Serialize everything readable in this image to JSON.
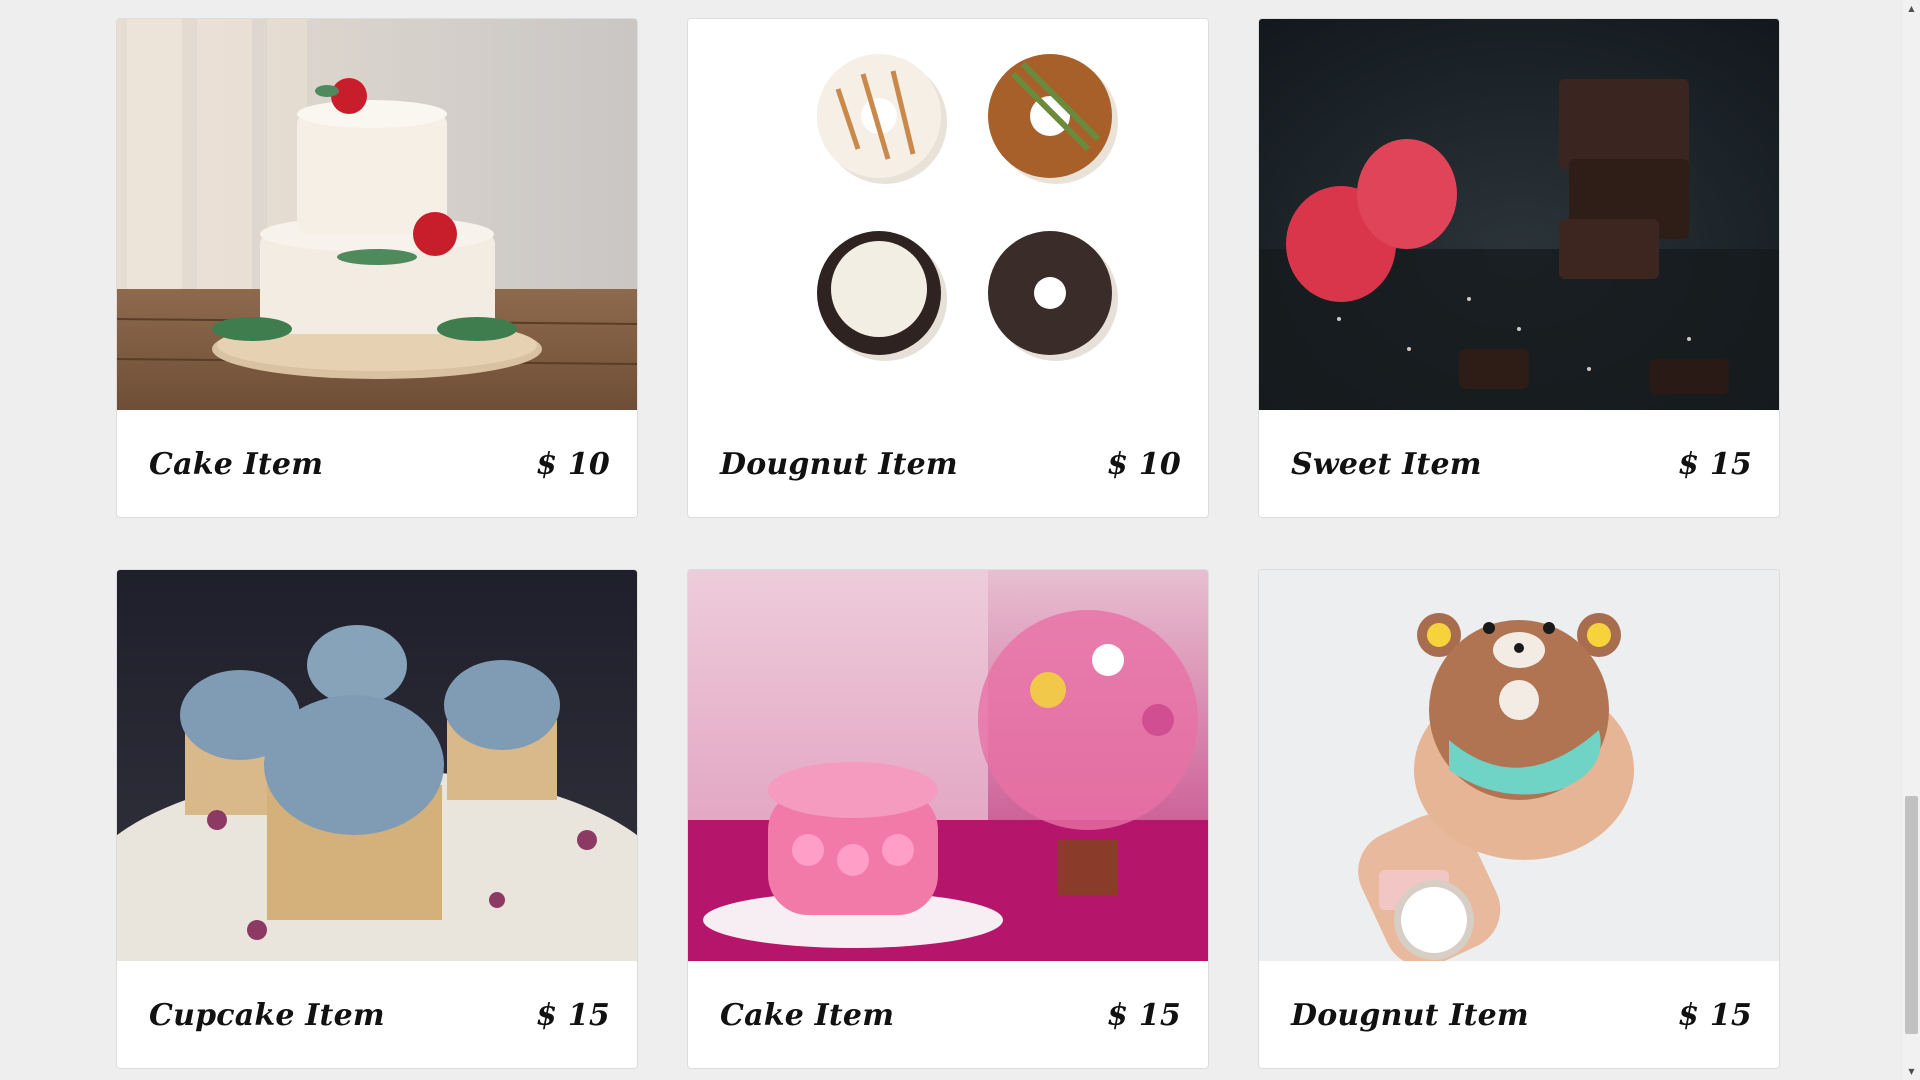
{
  "products": [
    {
      "name": "Cake Item",
      "price": "$ 10",
      "image": "tiered-cake-photo"
    },
    {
      "name": "Dougnut Item",
      "price": "$ 10",
      "image": "four-doughnuts-photo"
    },
    {
      "name": "Sweet Item",
      "price": "$ 15",
      "image": "chocolate-raspberry-photo"
    },
    {
      "name": "Cupcake Item",
      "price": "$ 15",
      "image": "blue-cupcakes-photo"
    },
    {
      "name": "Cake Item",
      "price": "$ 15",
      "image": "pink-rose-cake-photo"
    },
    {
      "name": "Dougnut Item",
      "price": "$ 15",
      "image": "bear-doughnut-hand-photo"
    }
  ],
  "scrollbar": {
    "position": 0.78
  },
  "colors": {
    "page_background": "#eeeeee",
    "card_background": "#ffffff",
    "text": "#111111"
  }
}
